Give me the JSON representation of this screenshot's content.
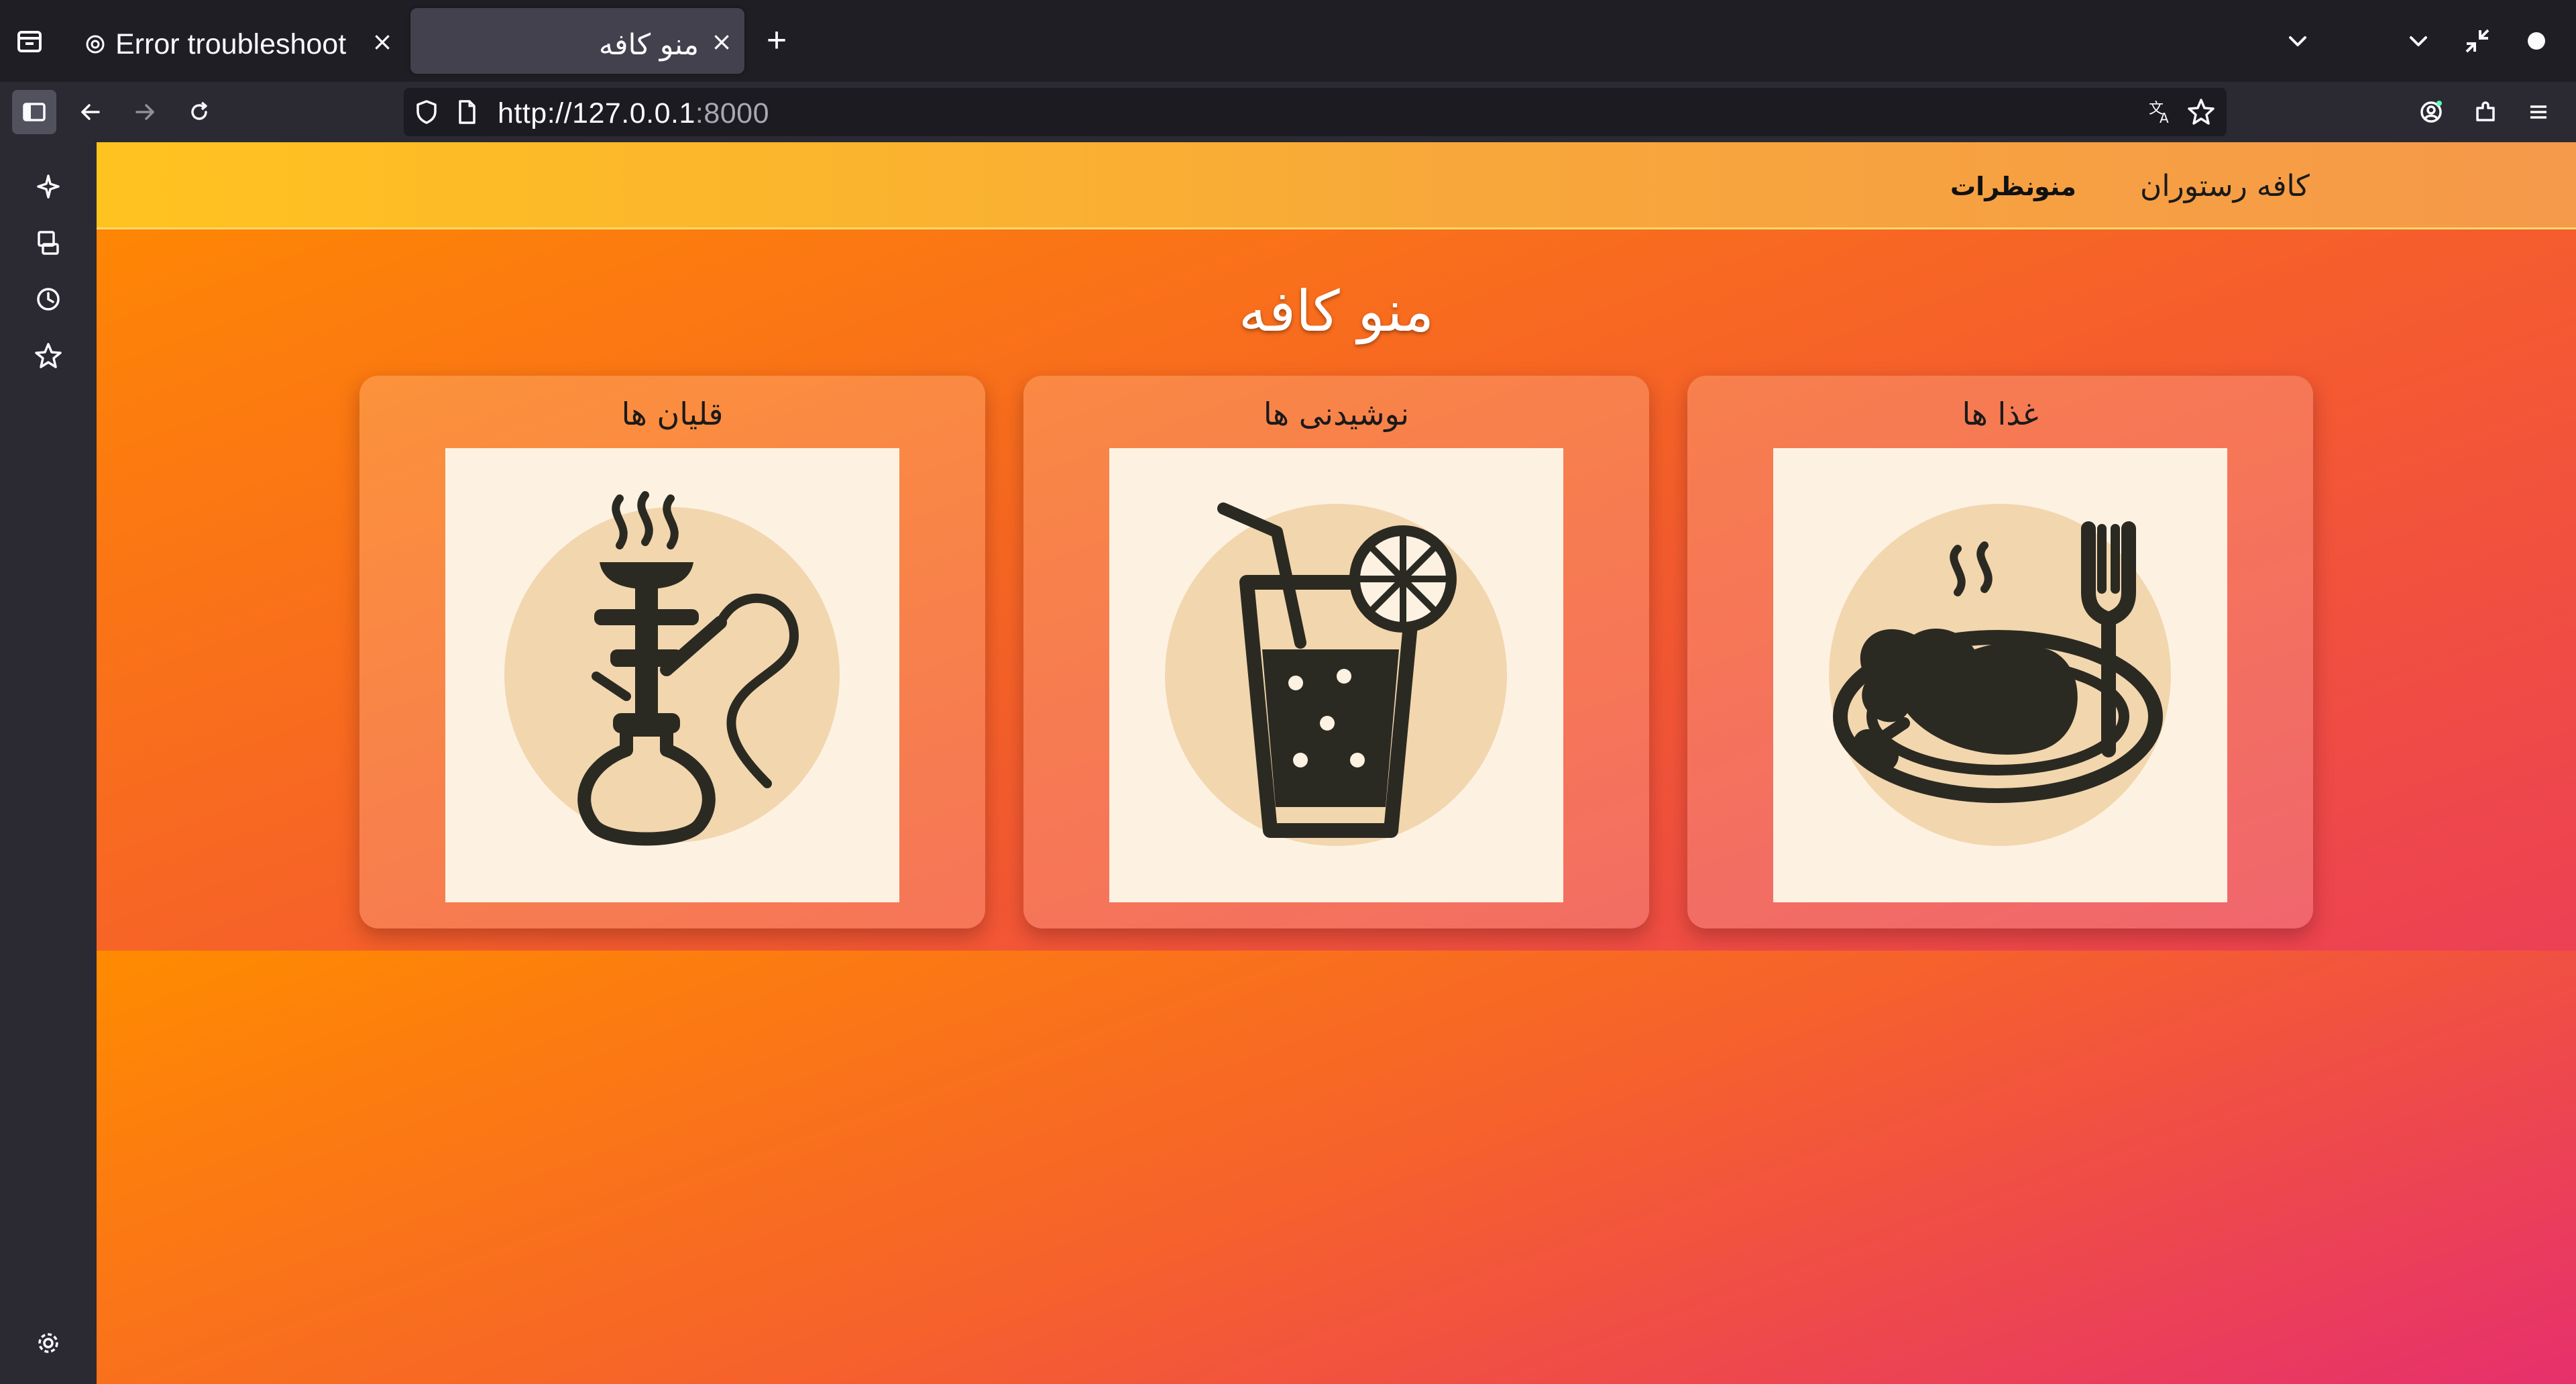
{
  "browser": {
    "tabs": [
      {
        "title": "Error troubleshoot",
        "active": false
      },
      {
        "title": "منو کافه",
        "active": true
      }
    ],
    "url": {
      "host": "http://127.0.0.1",
      "port": ":8000"
    }
  },
  "site": {
    "brand": "کافه رستوران",
    "nav": {
      "menu": "منو",
      "reviews": "نظرات"
    },
    "page_title": "منو کافه",
    "categories": [
      {
        "label": "غذا ها",
        "icon": "food-plate-icon"
      },
      {
        "label": "نوشیدنی ها",
        "icon": "drink-glass-icon"
      },
      {
        "label": "قلیان ها",
        "icon": "hookah-icon"
      }
    ]
  },
  "colors": {
    "header_start": "#ffc31f",
    "page_start": "#ff8a00",
    "page_end": "#e72f6c",
    "tile_bg": "#fdf2e2",
    "icon_circle": "#f2d6ae",
    "icon_ink": "#2b2a22"
  }
}
